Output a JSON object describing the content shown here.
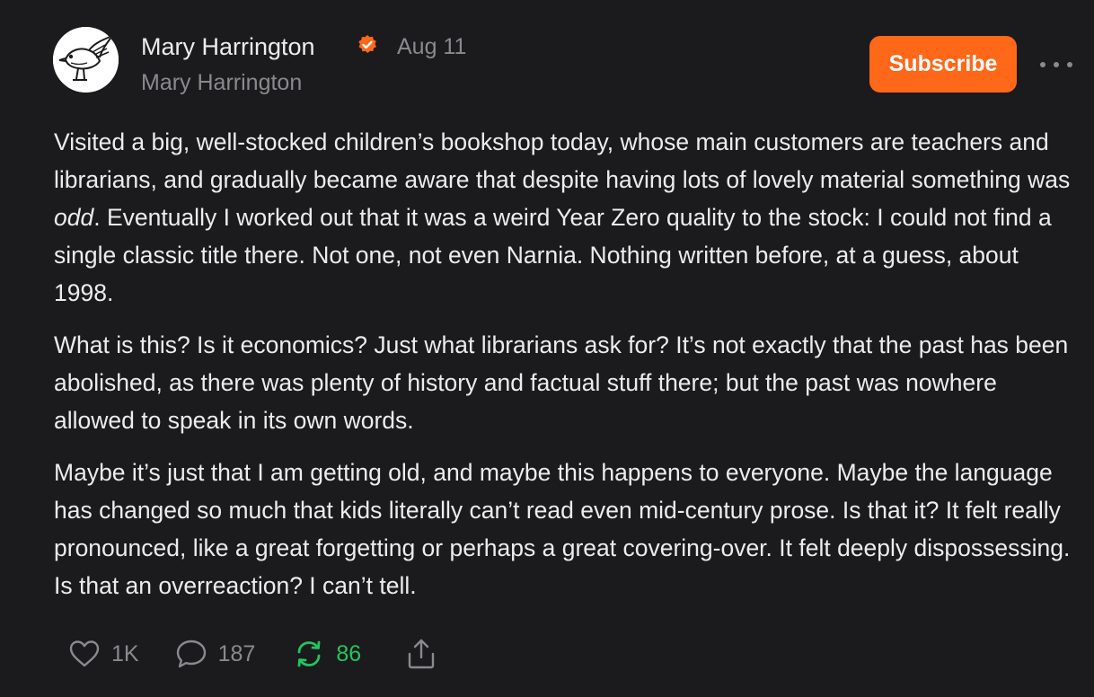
{
  "author": {
    "name": "Mary Harrington",
    "handle": "Mary Harrington",
    "avatar_icon": "bird-sketch-avatar",
    "verified_icon": "verified-badge-icon",
    "verified_color": "#ff6719"
  },
  "post": {
    "date": "Aug 11",
    "paragraph1_before": "Visited a big, well-stocked children’s bookshop today, whose main customers are teachers and librarians, and gradually became aware that despite having lots of lovely material something was ",
    "paragraph1_emphasis": "odd",
    "paragraph1_after": ". Eventually I worked out that it was a weird Year Zero quality to the stock: I could not find a single classic title there. Not one, not even Narnia. Nothing written before, at a guess, about 1998.",
    "paragraph2": "What is this? Is it economics? Just what librarians ask for? It’s not exactly that the past has been abolished, as there was plenty of history and factual stuff there; but the past was nowhere allowed to speak in its own words.",
    "paragraph3": "Maybe it’s just that I am getting old, and maybe this happens to everyone. Maybe the language has changed so much that kids literally can’t read even mid-century prose. Is that it? It felt really pronounced, like a great forgetting or perhaps a great covering-over. It felt deeply dispossessing. Is that an overreaction? I can’t tell."
  },
  "header": {
    "subscribe_label": "Subscribe",
    "subscribe_color": "#ff6719",
    "more_icon": "more-dots-icon"
  },
  "actions": {
    "likes": "1K",
    "comments": "187",
    "restacks": "86",
    "restack_color": "#22c55e",
    "like_icon": "heart-icon",
    "comment_icon": "comment-bubble-icon",
    "restack_icon": "restack-icon",
    "share_icon": "share-icon"
  }
}
